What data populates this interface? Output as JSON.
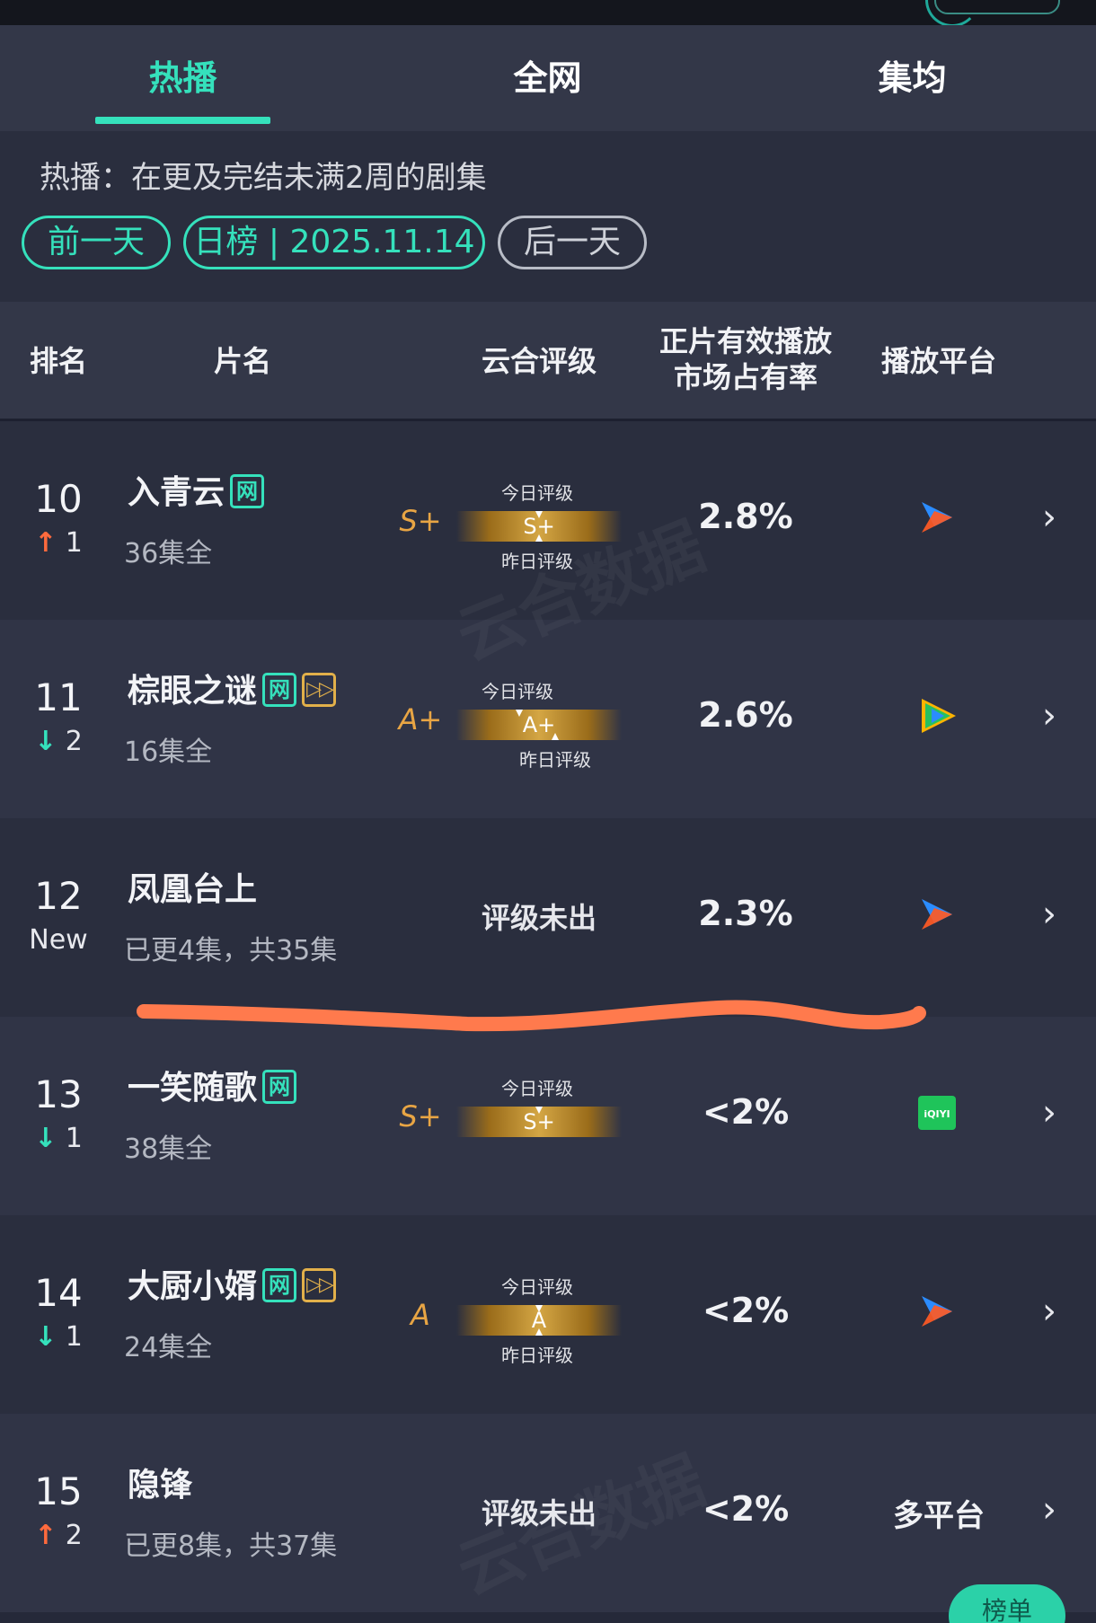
{
  "tabs": [
    {
      "label": "热播",
      "active": true
    },
    {
      "label": "全网",
      "active": false
    },
    {
      "label": "集均",
      "active": false
    }
  ],
  "description": "热播：在更及完结未满2周的剧集",
  "date_nav": {
    "prev_label": "前一天",
    "current_label": "日榜 | 2025.11.14",
    "next_label": "后一天"
  },
  "columns": {
    "rank": "排名",
    "title": "片名",
    "rating": "云合评级",
    "share_line1": "正片有效播放",
    "share_line2": "市场占有率",
    "platform": "播放平台"
  },
  "rating_labels": {
    "today": "今日评级",
    "yesterday": "昨日评级",
    "none": "评级未出"
  },
  "rows": [
    {
      "rank": "10",
      "change_dir": "up",
      "change_arrow": "↑",
      "change": "1",
      "title": "入青云",
      "badges": [
        "网"
      ],
      "subtitle": "36集全",
      "grade": "S+",
      "today_grade": "S+",
      "has_yesterday": true,
      "share": "2.8%",
      "platform": "youku"
    },
    {
      "rank": "11",
      "change_dir": "down",
      "change_arrow": "↓",
      "change": "2",
      "title": "棕眼之谜",
      "badges": [
        "网",
        "ff"
      ],
      "subtitle": "16集全",
      "grade": "A+",
      "today_grade": "A+",
      "has_yesterday": true,
      "share": "2.6%",
      "platform": "tencent"
    },
    {
      "rank": "12",
      "change_dir": "new",
      "change_arrow": "",
      "change": "New",
      "title": "凤凰台上",
      "badges": [],
      "subtitle": "已更4集，共35集",
      "grade": "",
      "today_grade": "",
      "has_yesterday": false,
      "share": "2.3%",
      "platform": "youku"
    },
    {
      "rank": "13",
      "change_dir": "down",
      "change_arrow": "↓",
      "change": "1",
      "title": "一笑随歌",
      "badges": [
        "网"
      ],
      "subtitle": "38集全",
      "grade": "S+",
      "today_grade": "S+",
      "has_yesterday": false,
      "share": "<2%",
      "platform": "iqiyi"
    },
    {
      "rank": "14",
      "change_dir": "down",
      "change_arrow": "↓",
      "change": "1",
      "title": "大厨小婿",
      "badges": [
        "网",
        "ff"
      ],
      "subtitle": "24集全",
      "grade": "A",
      "today_grade": "A",
      "has_yesterday": true,
      "share": "<2%",
      "platform": "youku"
    },
    {
      "rank": "15",
      "change_dir": "up",
      "change_arrow": "↑",
      "change": "2",
      "title": "隐锋",
      "badges": [],
      "subtitle": "已更8集，共37集",
      "grade": "",
      "today_grade": "",
      "has_yesterday": false,
      "share": "<2%",
      "platform": "multi",
      "platform_text": "多平台"
    }
  ],
  "badge_labels": {
    "net": "网",
    "ff": "▷▷"
  },
  "platform_logos": {
    "iqiyi": "iQIYI"
  },
  "fab_label": "榜单",
  "colors": {
    "accent": "#35e1bc",
    "up": "#ff6a3d",
    "grade": "#e8a544",
    "annotation": "#ff7a4d"
  }
}
